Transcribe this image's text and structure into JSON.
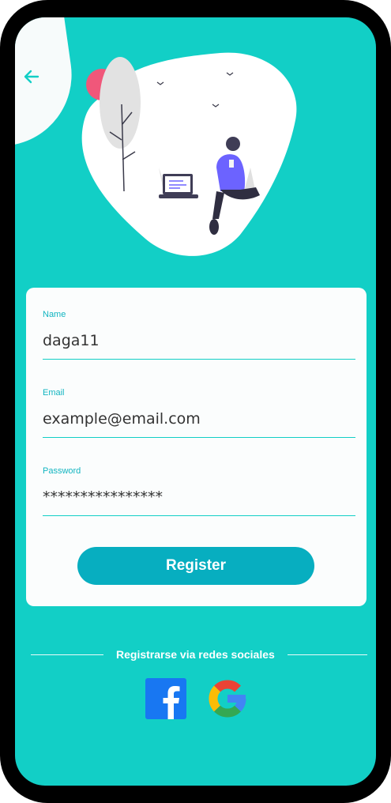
{
  "header": {
    "back_icon": "arrow-left-icon"
  },
  "form": {
    "name": {
      "label": "Name",
      "value": "daga11"
    },
    "email": {
      "label": "Email",
      "value": "example@email.com"
    },
    "password": {
      "label": "Password",
      "value": "****************"
    },
    "submit_label": "Register"
  },
  "social": {
    "divider_text": "Registrarse via redes sociales",
    "providers": [
      "facebook-icon",
      "google-icon"
    ]
  },
  "colors": {
    "background": "#12cfc6",
    "accent": "#12b5c1",
    "button": "#07aec0",
    "card": "#fbfdfd"
  }
}
